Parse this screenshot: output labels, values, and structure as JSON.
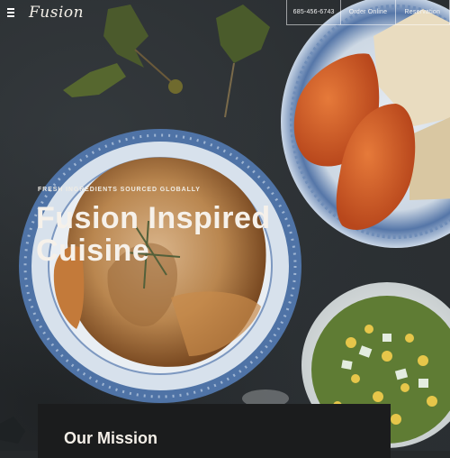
{
  "header": {
    "logo": "Fusion",
    "phone": "685-456-6743",
    "order_label": "Order Online",
    "reservation_label": "Reservation"
  },
  "hero": {
    "eyebrow": "FRESH INGREDIENTS SOURCED GLOBALLY",
    "title_line1": "Fusion Inspired",
    "title_line2": "Cuisine"
  },
  "mission": {
    "title": "Our Mission"
  },
  "icons": {
    "menu": "hamburger-icon"
  },
  "colors": {
    "background": "#2a2e31",
    "text": "#f6f1ea",
    "plate_blue": "#4f73a6",
    "panel": "#1b1c1d"
  }
}
